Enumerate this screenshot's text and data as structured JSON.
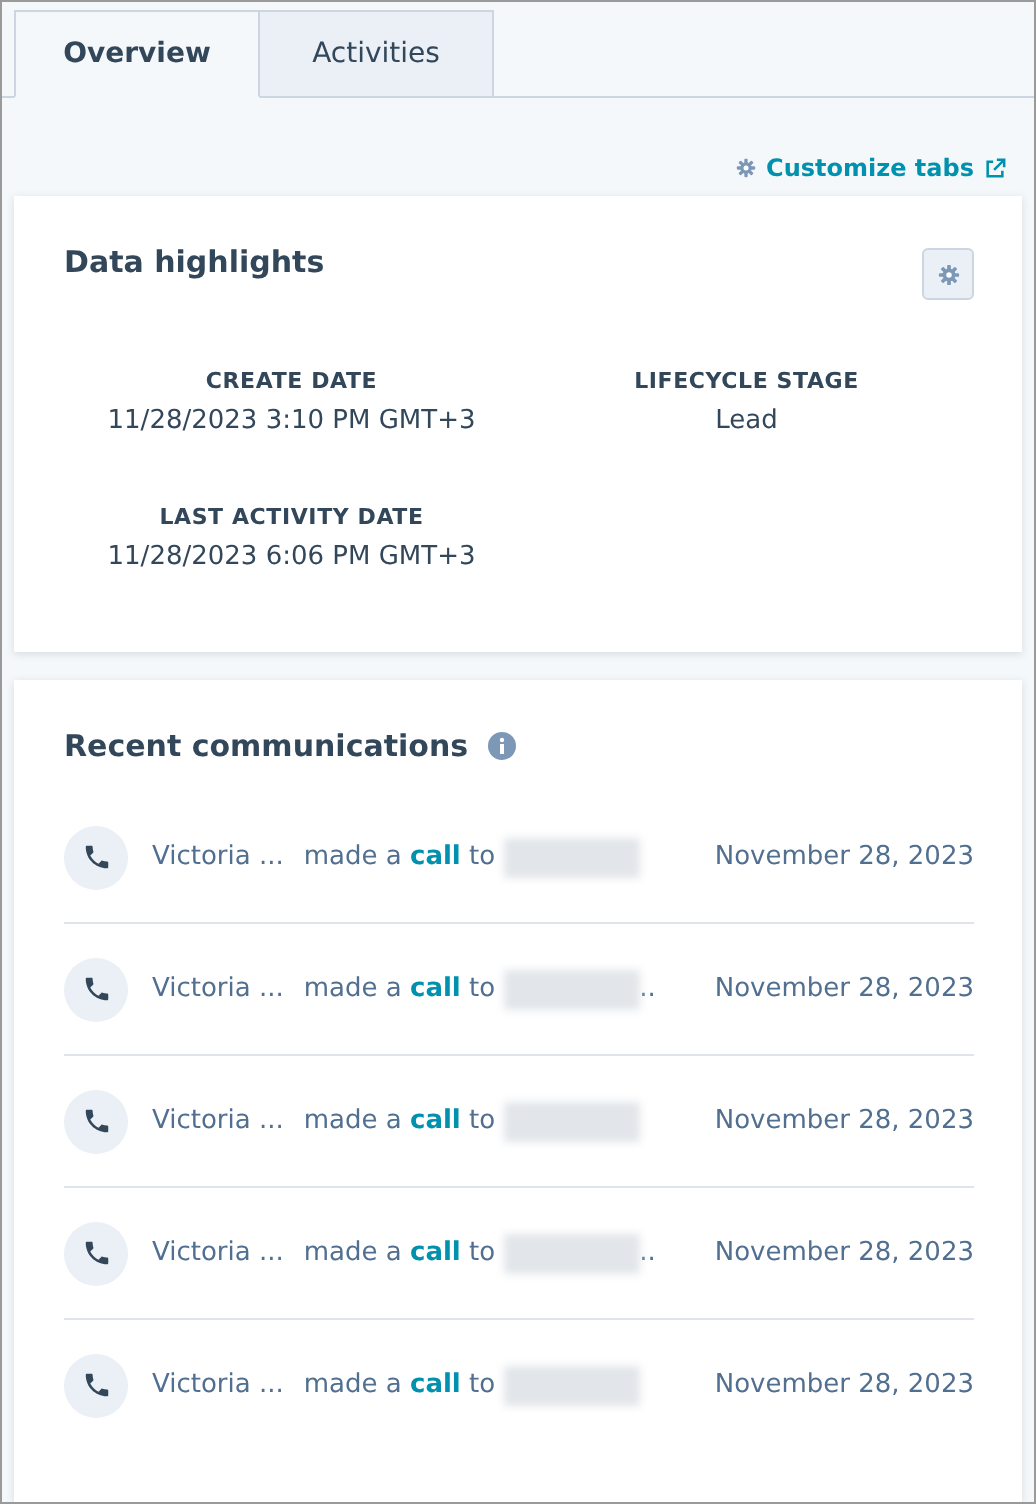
{
  "tabs": [
    {
      "label": "Overview",
      "selected": true
    },
    {
      "label": "Activities",
      "selected": false
    }
  ],
  "customize_link": {
    "label": "Customize tabs"
  },
  "data_highlights": {
    "title": "Data highlights",
    "fields": [
      {
        "label": "CREATE DATE",
        "value": "11/28/2023 3:10 PM GMT+3"
      },
      {
        "label": "LIFECYCLE STAGE",
        "value": "Lead"
      },
      {
        "label": "LAST ACTIVITY DATE",
        "value": "11/28/2023 6:06 PM GMT+3"
      }
    ]
  },
  "recent_communications": {
    "title": "Recent communications",
    "items": [
      {
        "author": "Victoria ...",
        "action": "made a **call** to",
        "date": "November 28, 2023"
      },
      {
        "author": "Victoria ...",
        "action": "made a **call** to",
        "redacted_suffix": "..",
        "date": "November 28, 2023"
      },
      {
        "author": "Victoria ...",
        "action": "made a **call** to",
        "date": "November 28, 2023"
      },
      {
        "author": "Victoria ...",
        "action": "made a **call** to",
        "redacted_suffix": "..",
        "date": "November 28, 2023"
      },
      {
        "author": "Victoria ...",
        "action": "made a **call** to",
        "date": "November 28, 2023"
      }
    ]
  }
}
